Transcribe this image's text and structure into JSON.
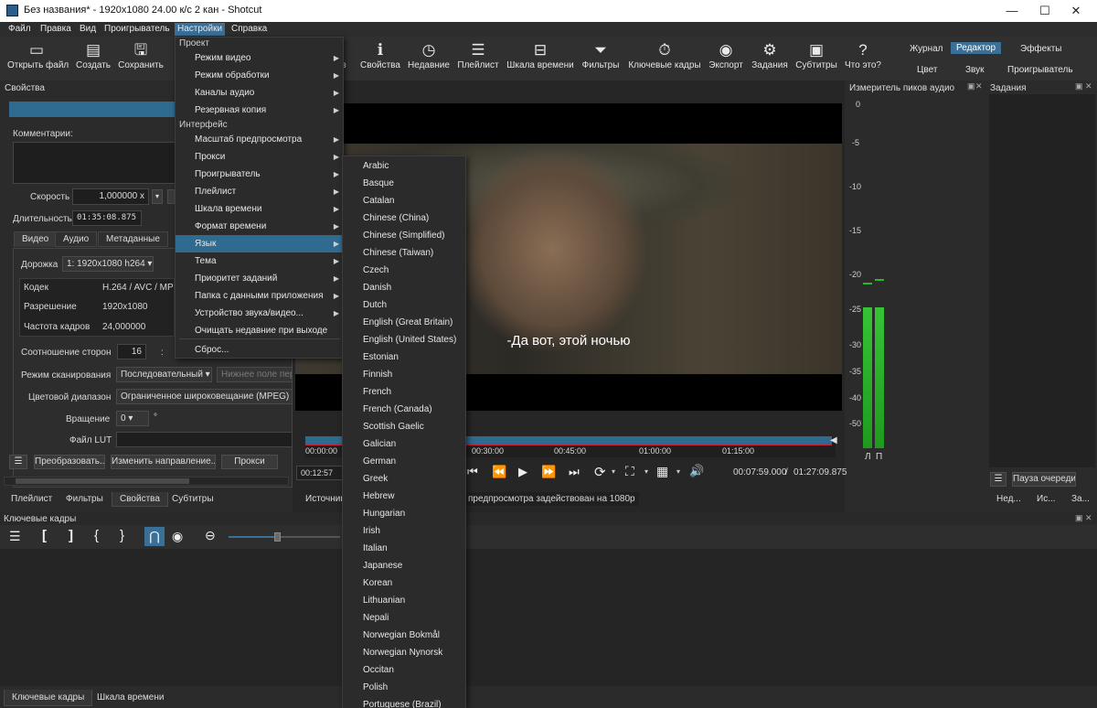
{
  "window": {
    "title": "Без названия* - 1920x1080 24.00 к/с 2 кан - Shotcut",
    "minimize": "—",
    "maximize": "☐",
    "close": "✕"
  },
  "menubar": [
    "Файл",
    "Правка",
    "Вид",
    "Проигрыватель",
    "Настройки",
    "Справка"
  ],
  "toolbar": {
    "left": [
      {
        "icon": "open-icon",
        "glyph": "▭",
        "label": "Открыть файл"
      },
      {
        "icon": "create-icon",
        "glyph": "▤",
        "label": "Создать"
      },
      {
        "icon": "save-icon",
        "glyph": "🖫",
        "label": "Сохранить"
      }
    ],
    "right": [
      {
        "icon": "properties-icon",
        "glyph": "ℹ",
        "label": "Свойства"
      },
      {
        "icon": "recent-icon",
        "glyph": "◷",
        "label": "Недавние"
      },
      {
        "icon": "playlist-icon",
        "glyph": "☰",
        "label": "Плейлист"
      },
      {
        "icon": "timeline-icon",
        "glyph": "⊟",
        "label": "Шкала времени"
      },
      {
        "icon": "filters-icon",
        "glyph": "⏷",
        "label": "Фильтры"
      },
      {
        "icon": "keyframes-icon",
        "glyph": "⏱",
        "label": "Ключевые кадры"
      },
      {
        "icon": "export-icon",
        "glyph": "◉",
        "label": "Экспорт"
      },
      {
        "icon": "jobs-icon",
        "glyph": "⚙",
        "label": "Задания"
      },
      {
        "icon": "subtitles-icon",
        "glyph": "▣",
        "label": "Субтитры"
      },
      {
        "icon": "whatsthis-icon",
        "glyph": "?",
        "label": "Что это?"
      }
    ],
    "partial_label": "в",
    "layouts": {
      "row1": [
        "Журнал",
        "Редактор",
        "Эффекты"
      ],
      "row2": [
        "Цвет",
        "Звук",
        "Проигрыватель"
      ],
      "selected": "Редактор"
    }
  },
  "properties": {
    "title": "Свойства",
    "comments_label": "Комментарии:",
    "speed_label": "Скорость",
    "speed_value": "1,000000 x",
    "duration_label": "Длительность",
    "duration_value": "01:35:08.875",
    "tabs": [
      "Видео",
      "Аудио",
      "Метаданные"
    ],
    "track_label": "Дорожка",
    "track_value": "1: 1920x1080 h264",
    "rows": [
      {
        "k": "Кодек",
        "v": "H.264 / AVC / MPEG"
      },
      {
        "k": "Разрешение",
        "v": "1920x1080"
      },
      {
        "k": "Частота кадров",
        "v": "24,000000"
      }
    ],
    "aspect_label": "Соотношение сторон",
    "aspect_num": "16",
    "aspect_sep": ":",
    "scan_label": "Режим сканирования",
    "scan_value": "Последовательный",
    "field_order_placeholder": "Нижнее поле первым",
    "range_label": "Цветовой диапазон",
    "range_value": "Ограниченное широковещание (MPEG)",
    "rotation_label": "Вращение",
    "rotation_value": "0",
    "rotation_unit": "°",
    "lut_label": "Файл LUT",
    "buttons": [
      "Преобразовать...",
      "Изменить направление...",
      "Прокси"
    ],
    "bottom_tabs": [
      "Плейлист",
      "Фильтры",
      "Свойства",
      "Субтитры"
    ],
    "bottom_selected": "Свойства"
  },
  "player": {
    "subtitle": "-Да вот, этой ночью",
    "ruler": [
      "00:00:00",
      "00:30:00",
      "00:45:00",
      "01:00:00",
      "01:15:00"
    ],
    "position_left": "00:12:57",
    "time_current": "00:07:59.000",
    "time_sep": "/",
    "time_total": "01:27:09.875",
    "source_tab": "Источник",
    "status": "предпросмотра задействован на 1080p"
  },
  "audio_meter": {
    "title": "Измеритель пиков аудио",
    "ticks": [
      "0",
      "-5",
      "-10",
      "-15",
      "-20",
      "-25",
      "-30",
      "-35",
      "-40",
      "-50"
    ],
    "left": "Л",
    "right": "П",
    "level_db": -24
  },
  "jobs": {
    "title": "Задания",
    "pause_label": "Пауза очереди",
    "tabs": [
      "Нед...",
      "Ис...",
      "За..."
    ]
  },
  "keyframes": {
    "title": "Ключевые кадры"
  },
  "bottom_tabs": [
    "Ключевые кадры",
    "Шкала времени"
  ],
  "settings_menu": {
    "section_project": "Проект",
    "project_items": [
      "Режим видео",
      "Режим обработки",
      "Каналы аудио",
      "Резервная копия"
    ],
    "section_interface": "Интерфейс",
    "interface_items": [
      "Масштаб предпросмотра",
      "Прокси",
      "Проигрыватель",
      "Плейлист",
      "Шкала времени",
      "Формат времени",
      "Язык",
      "Тема",
      "Приоритет заданий",
      "Папка с данными приложения",
      "Устройство звука/видео...",
      "Очищать недавние при выходе",
      "Сброс..."
    ],
    "highlighted": "Язык"
  },
  "language_menu": [
    "Arabic",
    "Basque",
    "Catalan",
    "Chinese (China)",
    "Chinese (Simplified)",
    "Chinese (Taiwan)",
    "Czech",
    "Danish",
    "Dutch",
    "English (Great Britain)",
    "English (United States)",
    "Estonian",
    "Finnish",
    "French",
    "French (Canada)",
    "Scottish Gaelic",
    "Galician",
    "German",
    "Greek",
    "Hebrew",
    "Hungarian",
    "Irish",
    "Italian",
    "Japanese",
    "Korean",
    "Lithuanian",
    "Nepali",
    "Norwegian Bokmål",
    "Norwegian Nynorsk",
    "Occitan",
    "Polish",
    "Portuguese (Brazil)"
  ],
  "colors": {
    "accent": "#3a6f97",
    "meter_green": "#2db52d",
    "timeline_blue": "#2f6b91"
  }
}
